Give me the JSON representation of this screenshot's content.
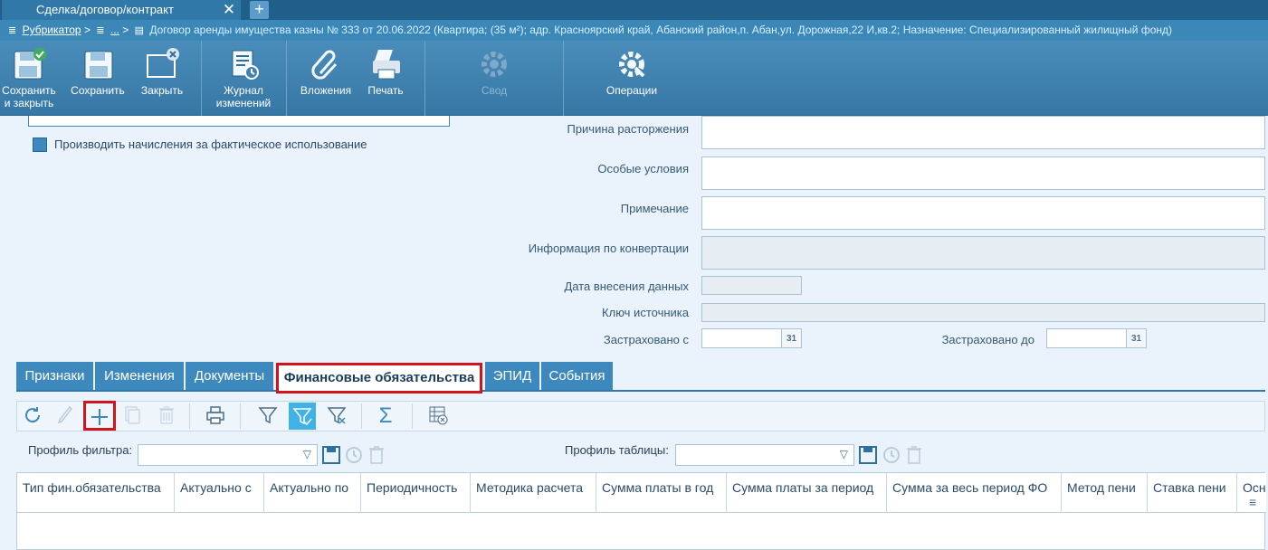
{
  "window_tab": {
    "title": "Сделка/договор/контракт",
    "close": "✕",
    "new_tab": "+"
  },
  "breadcrumb": {
    "root": "Рубрикатор",
    "ellipsis": "...",
    "sep": ">",
    "title": "Договор аренды имущества казны № 333 от 20.06.2022 (Квартира; (35 м²); адр. Красноярский край, Абанский район,п. Абан,ул. Дорожная,22 И,кв.2; Назначение: Специализированный жилищный фонд)"
  },
  "toolbar": {
    "save_close_line1": "Сохранить",
    "save_close_line2": "и закрыть",
    "save": "Сохранить",
    "close": "Закрыть",
    "journal_line1": "Журнал",
    "journal_line2": "изменений",
    "attachments": "Вложения",
    "print": "Печать",
    "summary": "Свод",
    "operations": "Операции"
  },
  "form": {
    "checkbox_label": "Производить начисления за фактическое использование",
    "termination_reason": "Причина расторжения",
    "special_terms": "Особые условия",
    "note": "Примечание",
    "conversion_info": "Информация по конвертации",
    "entry_date": "Дата внесения данных",
    "source_key": "Ключ источника",
    "insured_from": "Застраховано с",
    "insured_to": "Застраховано до",
    "cal_label": "31"
  },
  "tabs": [
    "Признаки",
    "Изменения",
    "Документы",
    "Финансовые обязательства",
    "ЭПИД",
    "События"
  ],
  "filter": {
    "filter_profile": "Профиль фильтра:",
    "table_profile": "Профиль таблицы:",
    "sum_symbol": "Σ"
  },
  "grid_columns": [
    "Тип фин.обязательства",
    "Актуально с",
    "Актуально по",
    "Периодичность",
    "Методика расчета",
    "Сумма платы в год",
    "Сумма платы за период",
    "Сумма за весь период ФО",
    "Метод пени",
    "Ставка пени",
    "Осн"
  ],
  "colors": {
    "toolbar": "#3f82b2",
    "tab_active_outline": "#d0141c",
    "accent": "#3d89bd"
  }
}
